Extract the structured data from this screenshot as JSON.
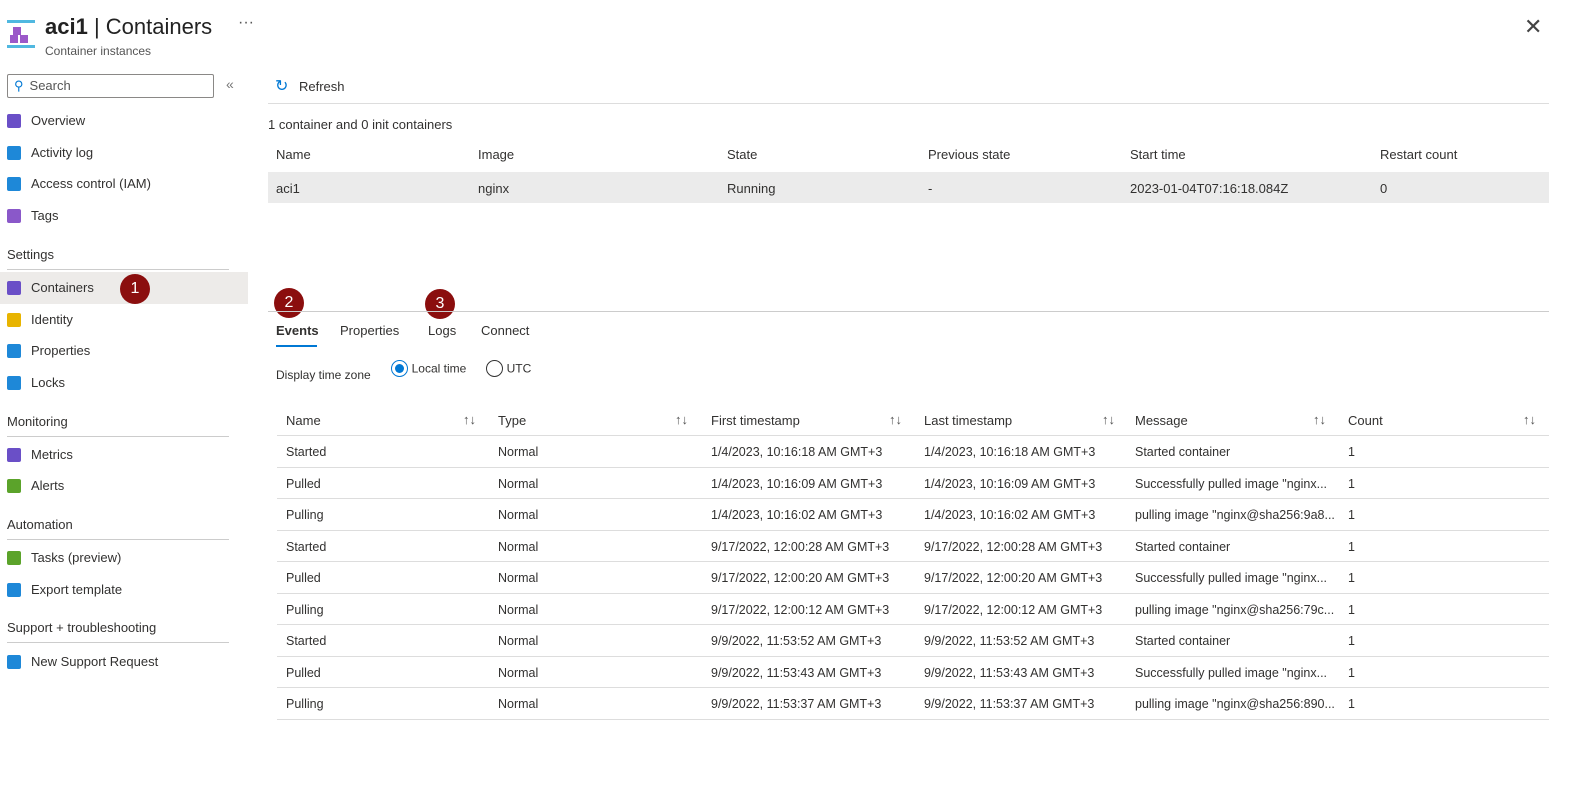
{
  "header": {
    "resource": "aci1",
    "page": "Containers",
    "subtitle": "Container instances",
    "more": "···",
    "close": "✕"
  },
  "sidebar": {
    "search_placeholder": "Search",
    "collapse": "«",
    "items_top": [
      {
        "label": "Overview",
        "color": "#6a4fc7"
      },
      {
        "label": "Activity log",
        "color": "#1e88d8"
      },
      {
        "label": "Access control (IAM)",
        "color": "#1e88d8"
      },
      {
        "label": "Tags",
        "color": "#8a58c9"
      }
    ],
    "sections": [
      {
        "title": "Settings",
        "items": [
          {
            "label": "Containers",
            "color": "#6a4fc7"
          },
          {
            "label": "Identity",
            "color": "#e8b400"
          },
          {
            "label": "Properties",
            "color": "#1e88d8"
          },
          {
            "label": "Locks",
            "color": "#1e88d8"
          }
        ]
      },
      {
        "title": "Monitoring",
        "items": [
          {
            "label": "Metrics",
            "color": "#6a4fc7"
          },
          {
            "label": "Alerts",
            "color": "#5ba32a"
          }
        ]
      },
      {
        "title": "Automation",
        "items": [
          {
            "label": "Tasks (preview)",
            "color": "#5ba32a"
          },
          {
            "label": "Export template",
            "color": "#1e88d8"
          }
        ]
      },
      {
        "title": "Support + troubleshooting",
        "items": [
          {
            "label": "New Support Request",
            "color": "#1e88d8"
          }
        ]
      }
    ]
  },
  "toolbar": {
    "refresh": "Refresh"
  },
  "summary": "1 container and 0 init containers",
  "containers": {
    "headers": [
      "Name",
      "Image",
      "State",
      "Previous state",
      "Start time",
      "Restart count"
    ],
    "rows": [
      [
        "aci1",
        "nginx",
        "Running",
        "-",
        "2023-01-04T07:16:18.084Z",
        "0"
      ]
    ]
  },
  "badges": [
    "1",
    "2",
    "3"
  ],
  "tabs": [
    "Events",
    "Properties",
    "Logs",
    "Connect"
  ],
  "timezone": {
    "label": "Display time zone",
    "options": [
      "Local time",
      "UTC"
    ],
    "selected": "Local time"
  },
  "events": {
    "headers": [
      "Name",
      "Type",
      "First timestamp",
      "Last timestamp",
      "Message",
      "Count"
    ],
    "rows": [
      [
        "Started",
        "Normal",
        "1/4/2023, 10:16:18 AM GMT+3",
        "1/4/2023, 10:16:18 AM GMT+3",
        "Started container",
        "1"
      ],
      [
        "Pulled",
        "Normal",
        "1/4/2023, 10:16:09 AM GMT+3",
        "1/4/2023, 10:16:09 AM GMT+3",
        "Successfully pulled image \"nginx...",
        "1"
      ],
      [
        "Pulling",
        "Normal",
        "1/4/2023, 10:16:02 AM GMT+3",
        "1/4/2023, 10:16:02 AM GMT+3",
        "pulling image \"nginx@sha256:9a8...",
        "1"
      ],
      [
        "Started",
        "Normal",
        "9/17/2022, 12:00:28 AM GMT+3",
        "9/17/2022, 12:00:28 AM GMT+3",
        "Started container",
        "1"
      ],
      [
        "Pulled",
        "Normal",
        "9/17/2022, 12:00:20 AM GMT+3",
        "9/17/2022, 12:00:20 AM GMT+3",
        "Successfully pulled image \"nginx...",
        "1"
      ],
      [
        "Pulling",
        "Normal",
        "9/17/2022, 12:00:12 AM GMT+3",
        "9/17/2022, 12:00:12 AM GMT+3",
        "pulling image \"nginx@sha256:79c...",
        "1"
      ],
      [
        "Started",
        "Normal",
        "9/9/2022, 11:53:52 AM GMT+3",
        "9/9/2022, 11:53:52 AM GMT+3",
        "Started container",
        "1"
      ],
      [
        "Pulled",
        "Normal",
        "9/9/2022, 11:53:43 AM GMT+3",
        "9/9/2022, 11:53:43 AM GMT+3",
        "Successfully pulled image \"nginx...",
        "1"
      ],
      [
        "Pulling",
        "Normal",
        "9/9/2022, 11:53:37 AM GMT+3",
        "9/9/2022, 11:53:37 AM GMT+3",
        "pulling image \"nginx@sha256:890...",
        "1"
      ]
    ]
  }
}
